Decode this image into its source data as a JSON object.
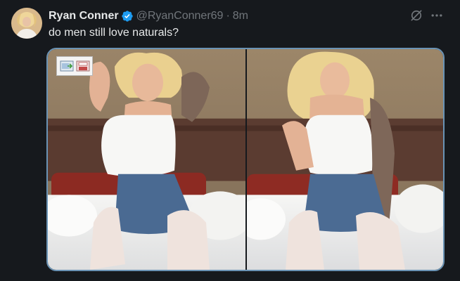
{
  "author": {
    "display_name": "Ryan Conner",
    "handle": "@RyanConner69",
    "separator": "·",
    "timestamp": "8m",
    "verified": true
  },
  "tweet": {
    "text": "do men still love naturals?"
  },
  "media": {
    "image_count": 2
  },
  "icons": {
    "verified": "verified-badge-icon",
    "grok": "grok-icon",
    "more": "more-icon",
    "send_to": "image-send-icon",
    "save": "image-save-icon"
  },
  "colors": {
    "background": "#16191d",
    "primary_text": "#e7e9ea",
    "secondary_text": "#71767b",
    "verified_blue": "#1d9bf0",
    "media_border": "#6a93b5"
  }
}
